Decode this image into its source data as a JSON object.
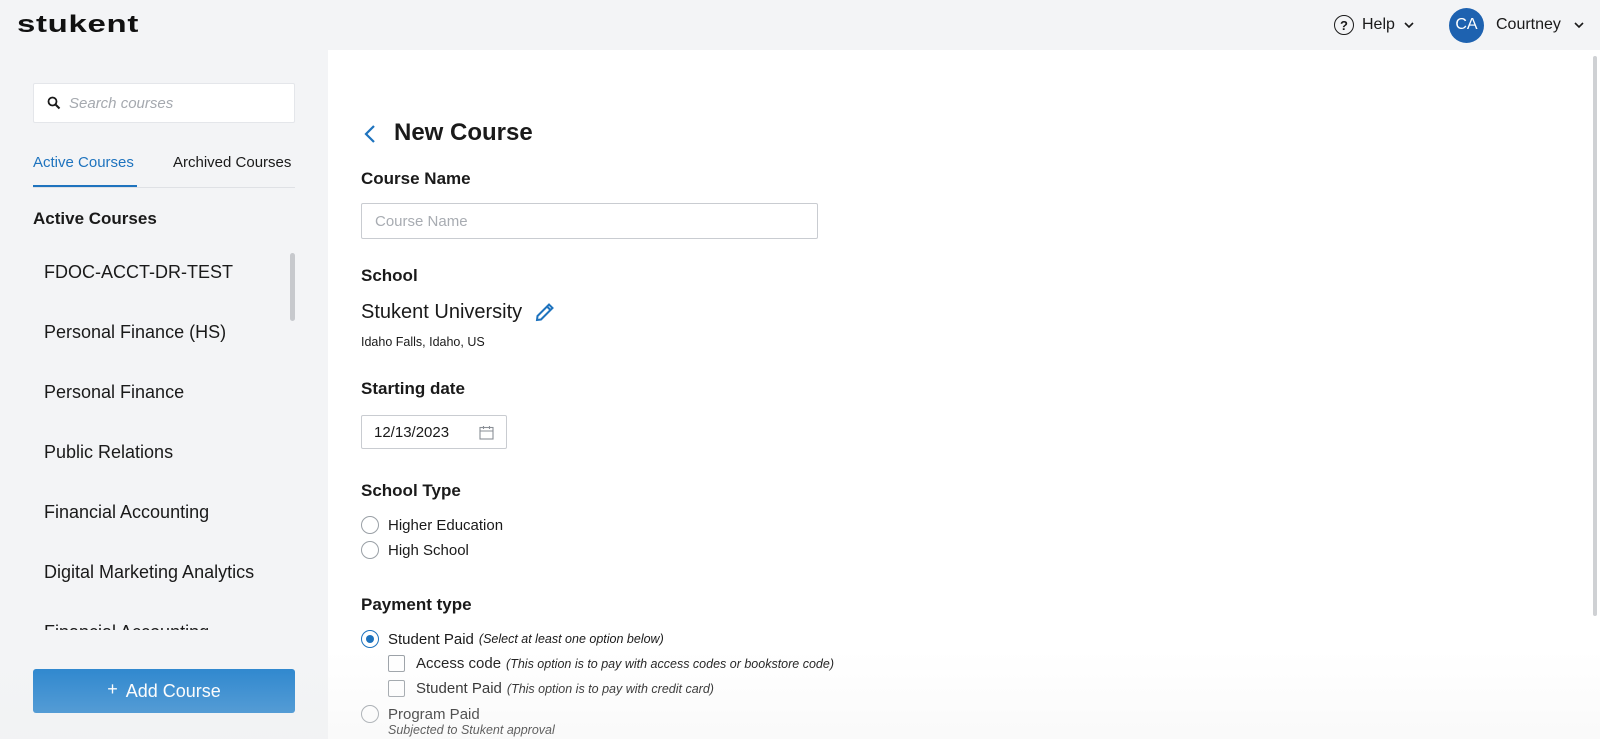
{
  "header": {
    "logo_text": "stukent",
    "help_label": "Help",
    "user_initials": "CA",
    "user_name": "Courtney",
    "avatar_color": "#1e62b0"
  },
  "sidebar": {
    "search_placeholder": "Search courses",
    "tabs": [
      {
        "label": "Active Courses",
        "active": true
      },
      {
        "label": "Archived Courses",
        "active": false
      }
    ],
    "section_heading": "Active Courses",
    "courses": [
      "FDOC-ACCT-DR-TEST",
      "Personal Finance (HS)",
      "Personal Finance",
      "Public Relations",
      "Financial Accounting",
      "Digital Marketing Analytics",
      "Financial Accounting"
    ],
    "add_button_label": "Add Course",
    "accent_color": "#1e73be",
    "button_color": "#2180cc"
  },
  "form": {
    "title": "New Course",
    "course_name": {
      "label": "Course Name",
      "placeholder": "Course Name",
      "value": ""
    },
    "school": {
      "label": "School",
      "name": "Stukent University",
      "location": "Idaho Falls, Idaho, US"
    },
    "starting_date": {
      "label": "Starting date",
      "value": "12/13/2023"
    },
    "school_type": {
      "label": "School Type",
      "options": [
        {
          "label": "Higher Education",
          "selected": false
        },
        {
          "label": "High School",
          "selected": false
        }
      ]
    },
    "payment_type": {
      "label": "Payment type",
      "student_paid": {
        "label": "Student Paid",
        "note": "(Select at least one option below)",
        "selected": true
      },
      "sub_options": [
        {
          "label": "Access code",
          "note": "(This option is to pay with access codes or bookstore code)",
          "checked": false
        },
        {
          "label": "Student Paid",
          "note": "(This option is to pay with credit card)",
          "checked": false
        }
      ],
      "program_paid": {
        "label": "Program Paid",
        "note": "Subjected to Stukent approval",
        "selected": false
      }
    }
  }
}
